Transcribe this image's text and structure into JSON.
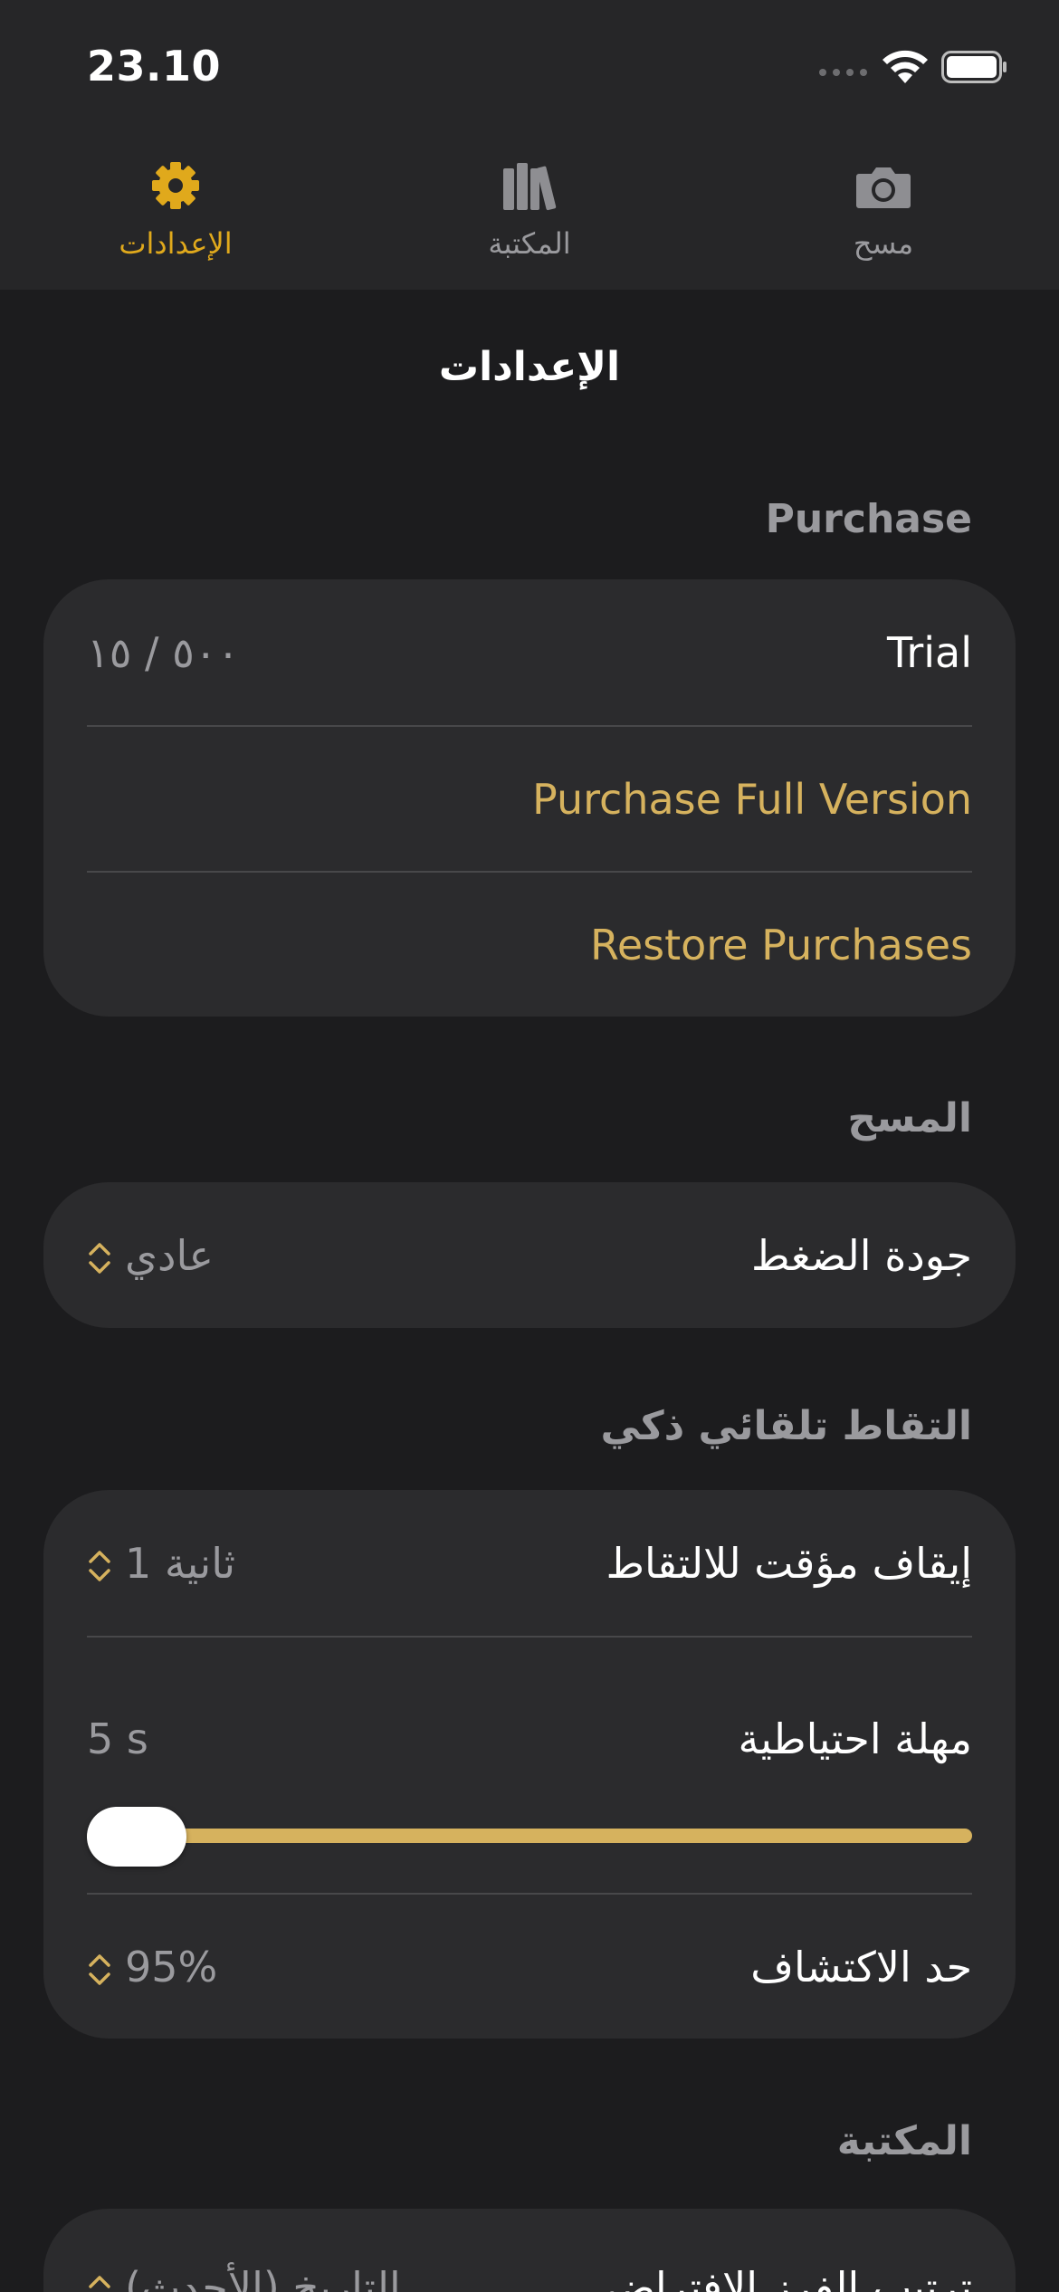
{
  "status": {
    "time": "23.10"
  },
  "tabs": [
    {
      "label": "الإعدادات",
      "icon": "gear-icon",
      "active": true
    },
    {
      "label": "المكتبة",
      "icon": "library-icon",
      "active": false
    },
    {
      "label": "مسح",
      "icon": "camera-icon",
      "active": false
    }
  ],
  "page": {
    "title": "الإعدادات"
  },
  "purchase": {
    "header": "Purchase",
    "trial_label": "Trial",
    "trial_value": "٥٠٠ / ١٥",
    "full_version": "Purchase Full Version",
    "restore": "Restore Purchases"
  },
  "scan": {
    "header": "المسح",
    "quality_label": "جودة الضغط",
    "quality_value": "عادي"
  },
  "auto": {
    "header": "التقاط تلقائي ذكي",
    "pause_label": "إيقاف مؤقت للالتقاط",
    "pause_value": "1 ثانية",
    "timeout_label": "مهلة احتياطية",
    "timeout_value": "5 s",
    "threshold_label": "حد الاكتشاف",
    "threshold_value": "95%"
  },
  "library": {
    "header": "المكتبة",
    "sort_label": "ترتيب الفرز الافتراضي",
    "sort_value": "التاريخ (الأحدث)"
  },
  "colors": {
    "accent": "#d6b25e",
    "tab_active": "#e0a91c",
    "background": "#1c1c1e",
    "card": "#2b2b2d"
  }
}
